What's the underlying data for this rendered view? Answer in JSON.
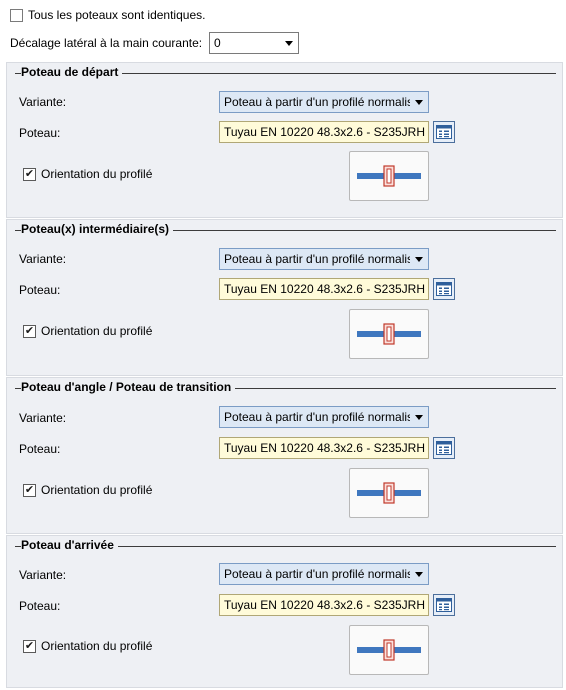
{
  "identical": {
    "label": "Tous les poteaux sont identiques.",
    "checked": false
  },
  "offset": {
    "label": "Décalage latéral à la main courante:",
    "value": "0"
  },
  "sections": [
    {
      "title": "Poteau de départ",
      "variante_label": "Variante:",
      "variante_value": "Poteau à partir d'un profilé normalisé",
      "poteau_label": "Poteau:",
      "poteau_value": "Tuyau EN 10220 48.3x2.6 - S235JRH",
      "orientation_label": "Orientation du profilé",
      "orientation_checked": true
    },
    {
      "title": "Poteau(x) intermédiaire(s)",
      "variante_label": "Variante:",
      "variante_value": "Poteau à partir d'un profilé normalisé",
      "poteau_label": "Poteau:",
      "poteau_value": "Tuyau EN 10220 48.3x2.6 - S235JRH",
      "orientation_label": "Orientation du profilé",
      "orientation_checked": true
    },
    {
      "title": "Poteau d'angle / Poteau de transition",
      "variante_label": "Variante:",
      "variante_value": "Poteau à partir d'un profilé normalisé",
      "poteau_label": "Poteau:",
      "poteau_value": "Tuyau EN 10220 48.3x2.6 - S235JRH",
      "orientation_label": "Orientation du profilé",
      "orientation_checked": true
    },
    {
      "title": "Poteau d'arrivée",
      "variante_label": "Variante:",
      "variante_value": "Poteau à partir d'un profilé normalisé",
      "poteau_label": "Poteau:",
      "poteau_value": "Tuyau EN 10220 48.3x2.6 - S235JRH",
      "orientation_label": "Orientation du profilé",
      "orientation_checked": true
    }
  ],
  "icons": {
    "catalog": "catalog-icon",
    "profile": "profile-orientation-icon",
    "check": "checkmark-icon",
    "dropdown": "chevron-down-icon"
  }
}
